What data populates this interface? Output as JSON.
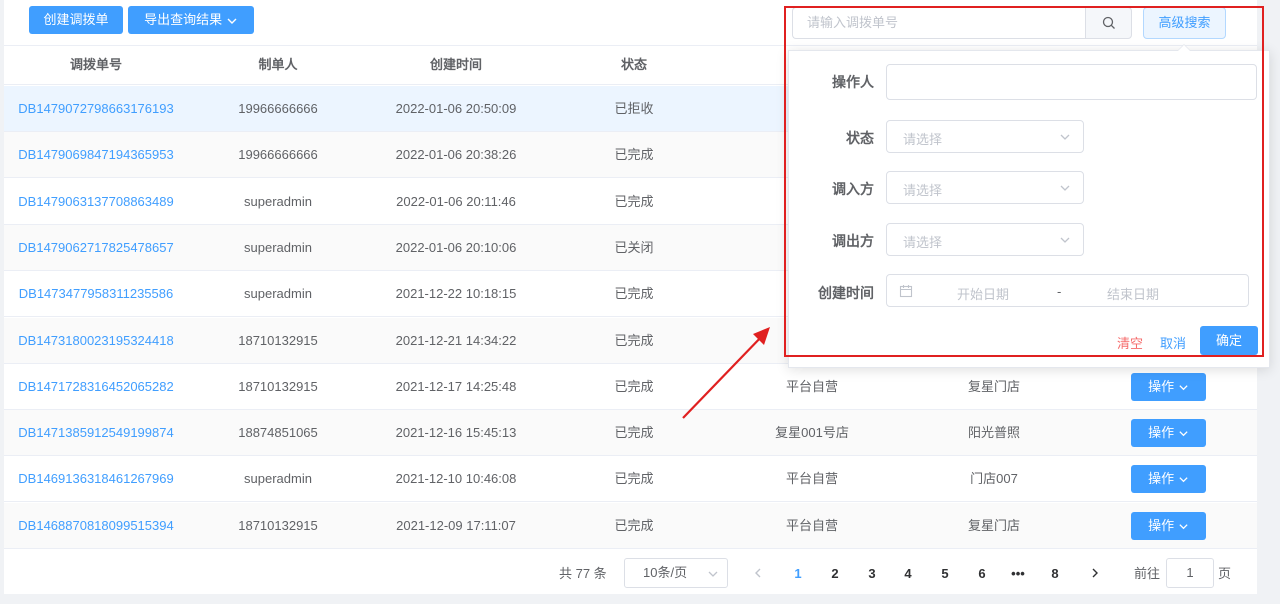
{
  "toolbar": {
    "create_label": "创建调拨单",
    "export_label": "导出查询结果"
  },
  "table": {
    "headers": [
      "调拨单号",
      "制单人",
      "创建时间",
      "状态"
    ],
    "rows": [
      {
        "no": "DB1479072798663176193",
        "maker": "19966666666",
        "time": "2022-01-06 20:50:09",
        "status": "已拒收",
        "in": "",
        "out": ""
      },
      {
        "no": "DB1479069847194365953",
        "maker": "19966666666",
        "time": "2022-01-06 20:38:26",
        "status": "已完成",
        "in": "",
        "out": ""
      },
      {
        "no": "DB1479063137708863489",
        "maker": "superadmin",
        "time": "2022-01-06 20:11:46",
        "status": "已完成",
        "in": "",
        "out": ""
      },
      {
        "no": "DB1479062717825478657",
        "maker": "superadmin",
        "time": "2022-01-06 20:10:06",
        "status": "已关闭",
        "in": "",
        "out": ""
      },
      {
        "no": "DB1473477958311235586",
        "maker": "superadmin",
        "time": "2021-12-22 10:18:15",
        "status": "已完成",
        "in": "",
        "out": ""
      },
      {
        "no": "DB1473180023195324418",
        "maker": "18710132915",
        "time": "2021-12-21 14:34:22",
        "status": "已完成",
        "in": "",
        "out": ""
      },
      {
        "no": "DB1471728316452065282",
        "maker": "18710132915",
        "time": "2021-12-17 14:25:48",
        "status": "已完成",
        "in": "平台自营",
        "out": "复星门店"
      },
      {
        "no": "DB1471385912549199874",
        "maker": "18874851065",
        "time": "2021-12-16 15:45:13",
        "status": "已完成",
        "in": "复星001号店",
        "out": "阳光普照"
      },
      {
        "no": "DB1469136318461267969",
        "maker": "superadmin",
        "time": "2021-12-10 10:46:08",
        "status": "已完成",
        "in": "平台自营",
        "out": "门店007"
      },
      {
        "no": "DB1468870818099515394",
        "maker": "18710132915",
        "time": "2021-12-09 17:11:07",
        "status": "已完成",
        "in": "平台自营",
        "out": "复星门店"
      }
    ],
    "op_label": "操作"
  },
  "pagination": {
    "total": "共 77 条",
    "page_size": "10条/页",
    "pages": [
      "1",
      "2",
      "3",
      "4",
      "5",
      "6",
      "•••",
      "8"
    ],
    "active_page": "1",
    "goto_prefix": "前往",
    "goto_value": "1",
    "goto_suffix": "页"
  },
  "search": {
    "placeholder": "请输入调拨单号",
    "advanced_label": "高级搜索"
  },
  "advanced": {
    "operator_label": "操作人",
    "status_label": "状态",
    "status_placeholder": "请选择",
    "in_label": "调入方",
    "in_placeholder": "请选择",
    "out_label": "调出方",
    "out_placeholder": "请选择",
    "created_label": "创建时间",
    "start_placeholder": "开始日期",
    "range_sep": "-",
    "end_placeholder": "结束日期",
    "clear_label": "清空",
    "cancel_label": "取消",
    "confirm_label": "确定"
  },
  "colors": {
    "primary": "#409eff",
    "danger": "#f56c6c",
    "annotation": "#e02020"
  }
}
